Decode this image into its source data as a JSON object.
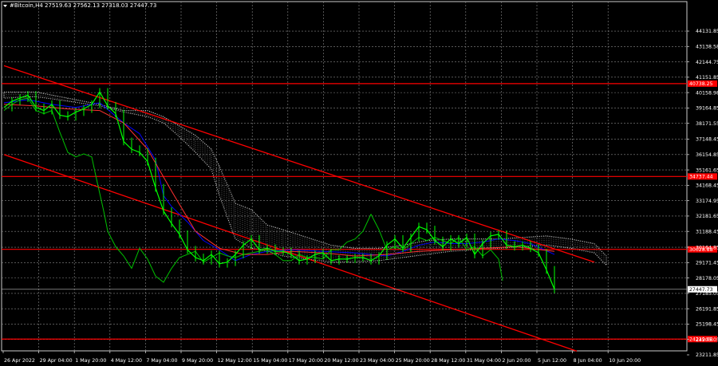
{
  "chart_data": {
    "type": "line",
    "title": "#Bitcoin,H4  27519.63 27562.13 27318.03 27447.73",
    "ylim": [
      23211.85,
      45111.85
    ],
    "y_ticks": [
      "44131.85",
      "43138.58",
      "42144.75",
      "41151.85",
      "40158.98",
      "39164.85",
      "38171.55",
      "37148.45",
      "36154.85",
      "35161.65",
      "34168.45",
      "33174.95",
      "32181.65",
      "31188.45",
      "30164.85",
      "29171.45",
      "28178.05",
      "27185.05",
      "26191.85",
      "25198.45",
      "24205.05",
      "23211.85"
    ],
    "price_levels": [
      {
        "value": 40738.25,
        "label": "40738.25",
        "color": "#ff0000"
      },
      {
        "value": 34737.44,
        "label": "34737.44",
        "color": "#ff0000"
      },
      {
        "value": 30028.88,
        "label": "30028.88",
        "color": "#ff0000"
      },
      {
        "value": 24229.08,
        "label": "24229.08",
        "color": "#ff0000"
      }
    ],
    "current_price": {
      "value": 27447.73,
      "label": "27447.73"
    },
    "x_ticks": [
      "26 Apr 2022",
      "29 Apr 04:00",
      "1 May 20:00",
      "4 May 12:00",
      "7 May 04:00",
      "9 May 20:00",
      "12 May 12:00",
      "15 May 04:00",
      "17 May 20:00",
      "20 May 12:00",
      "23 May 04:00",
      "25 May 20:00",
      "28 May 12:00",
      "31 May 04:00",
      "2 Jun 20:00",
      "5 Jun 12:00",
      "8 Jun 04:00",
      "10 Jun 20:00"
    ],
    "trend_channel": [
      {
        "x": [
          0,
          740
        ],
        "y": [
          41900,
          29200
        ]
      },
      {
        "x": [
          0,
          718
        ],
        "y": [
          36150,
          23450
        ]
      }
    ],
    "price": {
      "name": "",
      "x": [
        0,
        10,
        20,
        30,
        40,
        50,
        60,
        70,
        80,
        90,
        100,
        110,
        120,
        130,
        140,
        150,
        160,
        170,
        180,
        190,
        200,
        210,
        220,
        230,
        240,
        250,
        260,
        270,
        280,
        290,
        300,
        310,
        320,
        330,
        340,
        350,
        360,
        370,
        380,
        390,
        400,
        410,
        420,
        430,
        440,
        450,
        460,
        470,
        480,
        490,
        500,
        510,
        520,
        530,
        540,
        550,
        560,
        570,
        580,
        590,
        600,
        610,
        620,
        630,
        640,
        650,
        660,
        670,
        680,
        690
      ],
      "y": [
        39200,
        39600,
        39800,
        40000,
        39200,
        39000,
        39400,
        38700,
        38600,
        38900,
        39100,
        39400,
        40200,
        39300,
        38800,
        37000,
        36500,
        36300,
        35700,
        34000,
        32500,
        31700,
        31000,
        30000,
        29500,
        29300,
        29700,
        29100,
        29200,
        29700,
        30300,
        30700,
        30000,
        30100,
        29900,
        29900,
        29700,
        29300,
        29400,
        29700,
        29800,
        29300,
        29400,
        29400,
        29500,
        29500,
        29300,
        29600,
        30300,
        30700,
        30100,
        30800,
        31500,
        31300,
        30600,
        30200,
        30700,
        30400,
        30800,
        29700,
        30400,
        30900,
        31000,
        30300,
        30200,
        30300,
        30100,
        29800,
        28700,
        27450
      ]
    },
    "ma_lines": [
      {
        "name": "",
        "color": "#0000ff",
        "x": [
          0,
          30,
          60,
          90,
          120,
          150,
          170,
          190,
          200,
          210,
          230,
          250,
          270,
          290,
          310,
          330,
          360,
          400,
          440,
          480,
          500,
          520,
          540,
          560,
          580,
          600,
          620,
          640,
          660,
          690
        ],
        "y": [
          39500,
          39700,
          39400,
          39200,
          39500,
          38200,
          37500,
          35800,
          33500,
          32800,
          31800,
          30600,
          30000,
          29300,
          29700,
          29900,
          30000,
          29900,
          29800,
          29600,
          29900,
          30300,
          30500,
          30400,
          30400,
          30500,
          30700,
          30600,
          30400,
          29700
        ]
      },
      {
        "name": "",
        "color": "#ff3030",
        "x": [
          0,
          40,
          80,
          120,
          150,
          180,
          210,
          240,
          270,
          300,
          330,
          360,
          400,
          440,
          480,
          520,
          560,
          600,
          640,
          690
        ],
        "y": [
          39400,
          39300,
          39100,
          39000,
          38200,
          36500,
          33800,
          31200,
          30100,
          29700,
          29700,
          29900,
          29800,
          29600,
          29700,
          29900,
          30000,
          30100,
          30200,
          29900
        ]
      }
    ],
    "chikou": {
      "name": "",
      "color": "#00c000",
      "x": [
        0,
        10,
        20,
        30,
        40,
        50,
        60,
        70,
        80,
        90,
        100,
        110,
        115,
        125,
        130,
        140,
        150,
        160,
        170,
        180,
        190,
        200,
        210,
        220,
        230,
        240,
        250,
        260,
        270,
        280,
        290,
        300,
        310,
        320,
        330,
        340,
        350,
        360,
        370,
        380,
        390,
        400,
        410,
        420,
        430,
        440,
        450,
        460,
        470,
        480,
        490,
        500,
        510,
        520,
        530,
        540,
        550,
        560,
        570,
        580,
        590,
        600,
        610,
        620,
        625
      ],
      "y": [
        39000,
        39400,
        39700,
        39800,
        39000,
        38800,
        39000,
        37600,
        36300,
        36000,
        36200,
        36000,
        34800,
        32500,
        31200,
        30200,
        29600,
        28800,
        30100,
        29400,
        28300,
        27900,
        28800,
        29500,
        29700,
        29900,
        29200,
        29500,
        29800,
        29600,
        29500,
        29700,
        29800,
        29900,
        30000,
        29700,
        29300,
        29300,
        29700,
        29500,
        29500,
        29400,
        30000,
        30000,
        30500,
        30700,
        31200,
        32300,
        31300,
        30000,
        30200,
        30000,
        30400,
        30800,
        30600,
        30800,
        30600,
        30400,
        30800,
        30000,
        30200,
        29600,
        30000,
        29400,
        28000
      ]
    },
    "cloud": {
      "name": "",
      "color": "#d8d8d8",
      "x": [
        0,
        40,
        80,
        120,
        150,
        180,
        200,
        220,
        240,
        260,
        270,
        290,
        310,
        330,
        350,
        380,
        410,
        440,
        470,
        500,
        530,
        560,
        590,
        620,
        650,
        680,
        710,
        740,
        755
      ],
      "top": [
        40200,
        40200,
        39800,
        39400,
        39000,
        39000,
        38600,
        38000,
        37400,
        36500,
        35400,
        33000,
        32600,
        31600,
        31300,
        30800,
        30300,
        30100,
        30100,
        30300,
        30600,
        30700,
        30700,
        30700,
        30800,
        30900,
        30700,
        30400,
        29600
      ],
      "bottom": [
        39800,
        39900,
        39600,
        39300,
        38900,
        38600,
        38200,
        37300,
        36300,
        35200,
        33500,
        30700,
        30100,
        29900,
        29600,
        29400,
        29200,
        29200,
        29300,
        29500,
        29700,
        29900,
        30000,
        30100,
        30200,
        30300,
        30100,
        29800,
        29000
      ]
    }
  }
}
